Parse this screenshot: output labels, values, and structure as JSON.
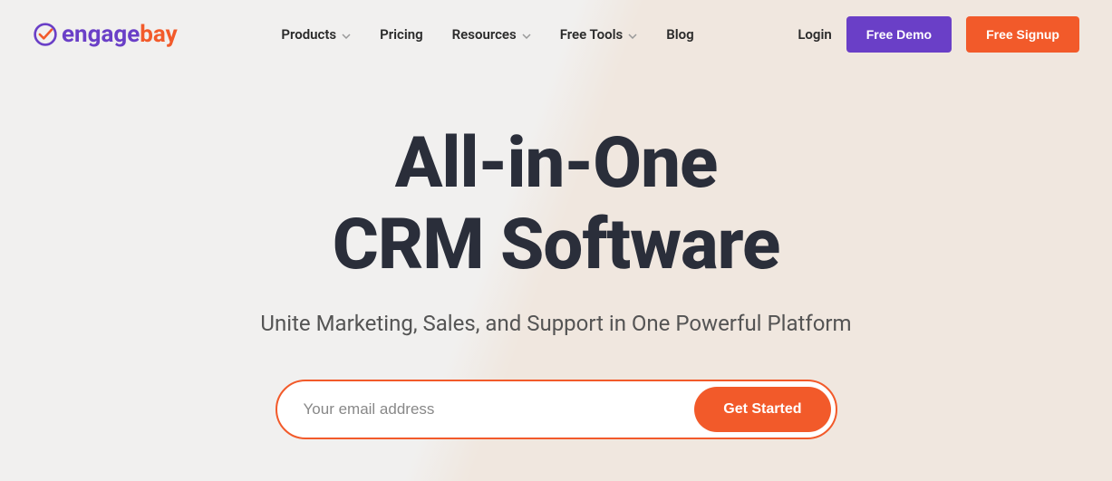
{
  "logo": {
    "part1": "engage",
    "part2": "bay"
  },
  "nav": {
    "products": "Products",
    "pricing": "Pricing",
    "resources": "Resources",
    "freetools": "Free Tools",
    "blog": "Blog",
    "login": "Login",
    "freedemo": "Free Demo",
    "freesignup": "Free Signup"
  },
  "hero": {
    "title_line1": "All-in-One",
    "title_line2": "CRM Software",
    "subtitle": "Unite Marketing, Sales, and Support in One Powerful Platform",
    "email_placeholder": "Your email address",
    "cta": "Get Started"
  }
}
